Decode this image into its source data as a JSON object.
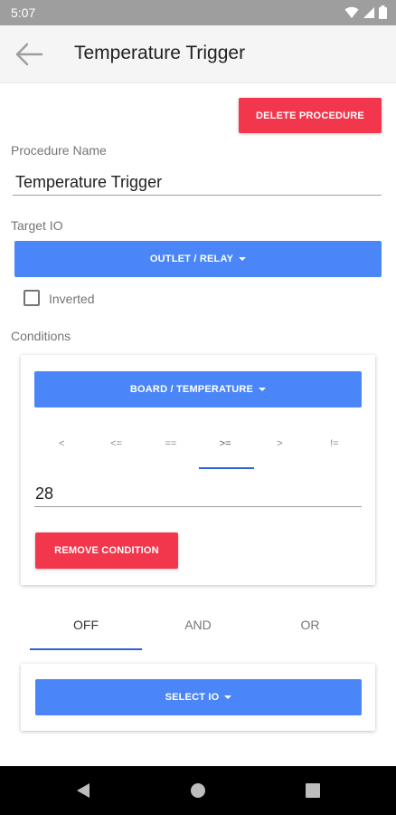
{
  "status_bar": {
    "time": "5:07",
    "icons": [
      "wifi-icon",
      "signal-icon",
      "battery-icon"
    ]
  },
  "app_bar": {
    "title": "Temperature Trigger",
    "back_icon": "arrow-back-icon"
  },
  "actions": {
    "delete_label": "DELETE PROCEDURE"
  },
  "procedure_name": {
    "label": "Procedure Name",
    "value": "Temperature Trigger"
  },
  "target_io": {
    "label": "Target IO",
    "select_label": "OUTLET / RELAY",
    "inverted_label": "Inverted",
    "inverted_checked": false
  },
  "conditions": {
    "label": "Conditions",
    "source_label": "BOARD / TEMPERATURE",
    "operators": [
      "<",
      "<=",
      "==",
      ">=",
      ">",
      "!="
    ],
    "selected_operator": ">=",
    "value": "28",
    "remove_label": "REMOVE CONDITION"
  },
  "logic": {
    "tabs": [
      "OFF",
      "AND",
      "OR"
    ],
    "selected": "OFF"
  },
  "select_io": {
    "label": "SELECT IO"
  },
  "colors": {
    "accent_red": "#f2374d",
    "accent_blue": "#4a86f7",
    "indicator": "#2f5fd6"
  }
}
